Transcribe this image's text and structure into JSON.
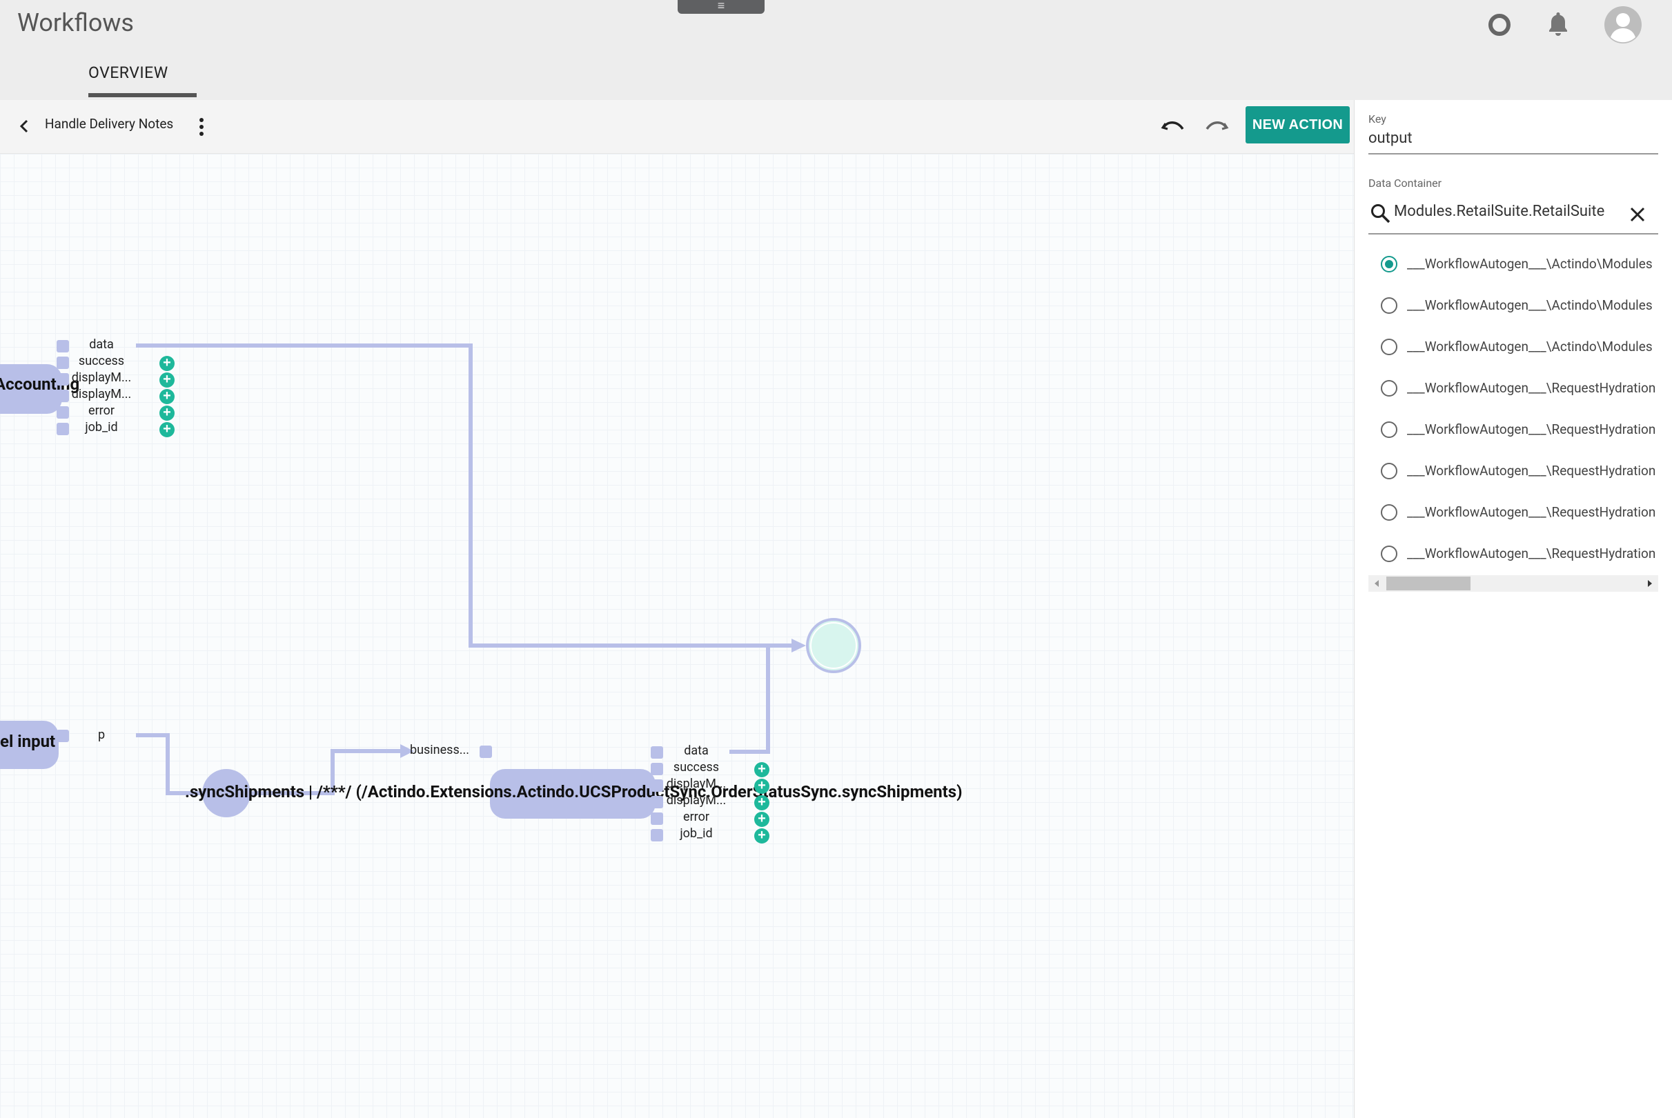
{
  "app": {
    "title": "Workflows",
    "menu_handle": "≡"
  },
  "header": {
    "icons": [
      "circle-status-icon",
      "bell-icon",
      "avatar-icon"
    ]
  },
  "tabs": [
    {
      "label": "OVERVIEW",
      "active": true
    }
  ],
  "toolbar": {
    "workflow_name": "Handle Delivery Notes",
    "new_action_label": "NEW ACTION"
  },
  "canvas": {
    "node_top": {
      "title": "Accounting",
      "ports": [
        "data",
        "success",
        "displayM...",
        "displayM...",
        "error",
        "job_id"
      ]
    },
    "node_input": {
      "title": "el input",
      "port": "p"
    },
    "node_sync": {
      "title": ".syncShipments | /***/ (/Actindo.Extensions.Actindo.UCSProductSync.OrderStatusSync.syncShipments)",
      "input_port": "business...",
      "ports": [
        "data",
        "success",
        "displayM...",
        "displayM...",
        "error",
        "job_id"
      ]
    }
  },
  "panel": {
    "key_label": "Key",
    "key_value": "output",
    "data_container_label": "Data Container",
    "search_value": "Modules.RetailSuite.RetailSuite",
    "options": [
      {
        "label": "___WorkflowAutogen___\\Actindo\\Modules",
        "checked": true
      },
      {
        "label": "___WorkflowAutogen___\\Actindo\\Modules",
        "checked": false
      },
      {
        "label": "___WorkflowAutogen___\\Actindo\\Modules",
        "checked": false
      },
      {
        "label": "___WorkflowAutogen___\\RequestHydration",
        "checked": false
      },
      {
        "label": "___WorkflowAutogen___\\RequestHydration",
        "checked": false
      },
      {
        "label": "___WorkflowAutogen___\\RequestHydration",
        "checked": false
      },
      {
        "label": "___WorkflowAutogen___\\RequestHydration",
        "checked": false
      },
      {
        "label": "___WorkflowAutogen___\\RequestHydration",
        "checked": false
      }
    ]
  },
  "colors": {
    "accent": "#149a8d",
    "wire": "#b8bfe8",
    "port_plus": "#1eb89b",
    "end_node": "#d8f5ee"
  }
}
